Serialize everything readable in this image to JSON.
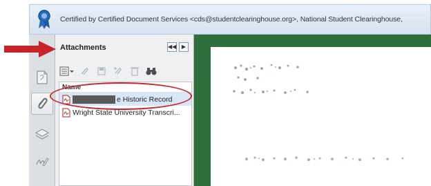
{
  "certification_bar": {
    "text": "Certified by Certified Document Services <cds@studentclearinghouse.org>, National Student Clearinghouse,",
    "icon": "certificate-ribbon-icon"
  },
  "navigation": {
    "buttons": [
      {
        "name": "page-thumbnails",
        "icon": "page-icon"
      },
      {
        "name": "attachments",
        "icon": "paperclip-icon",
        "active": true
      },
      {
        "name": "layers",
        "icon": "layers-icon"
      },
      {
        "name": "signatures",
        "icon": "signature-icon"
      }
    ]
  },
  "attachments_panel": {
    "title": "Attachments",
    "column_header": "Name",
    "items": [
      {
        "label": "e Historic Record",
        "redacted": true,
        "selected": true
      },
      {
        "label": "Wright State University Transcri..."
      }
    ]
  },
  "colors": {
    "annotation_red": "#c8222b",
    "viewer_background": "#2f6f3c",
    "panel_background": "#eef0f2"
  }
}
